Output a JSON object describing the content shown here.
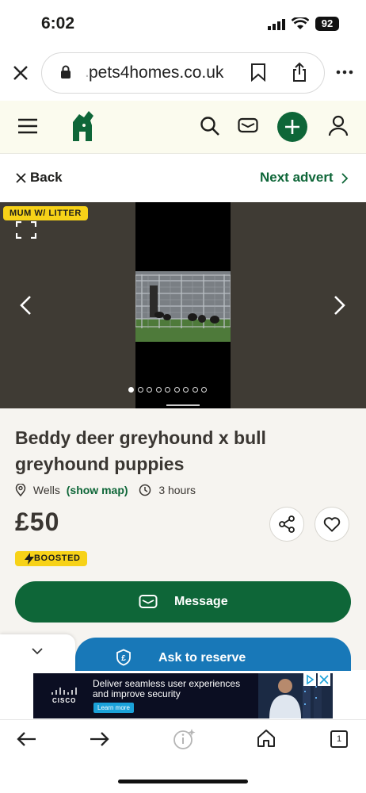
{
  "status_bar": {
    "time": "6:02",
    "battery": "92"
  },
  "browser": {
    "url": "pets4homes.co.uk",
    "url_prefix": "."
  },
  "nav": {
    "back_label": "Back",
    "next_label": "Next advert"
  },
  "gallery": {
    "badge": "MUM W/ LITTER",
    "dot_count": 9,
    "active_dot": 1
  },
  "listing": {
    "title": "Beddy deer greyhound x bull greyhound puppies",
    "location": "Wells",
    "show_map": "(show map)",
    "age": "3 hours",
    "price": "£50",
    "boosted": "BOOSTED"
  },
  "actions": {
    "message": "Message",
    "reserve": "Ask to reserve"
  },
  "ad": {
    "brand": "CISCO",
    "text_line1": "Deliver seamless user experiences",
    "text_line2": "and improve security",
    "cta": "Learn more"
  },
  "toolbar": {
    "tabs_count": "1"
  },
  "colors": {
    "brand_green": "#0e6638",
    "badge_yellow": "#f7d218",
    "reserve_blue": "#1878b8",
    "header_bg": "#fbfbee"
  }
}
